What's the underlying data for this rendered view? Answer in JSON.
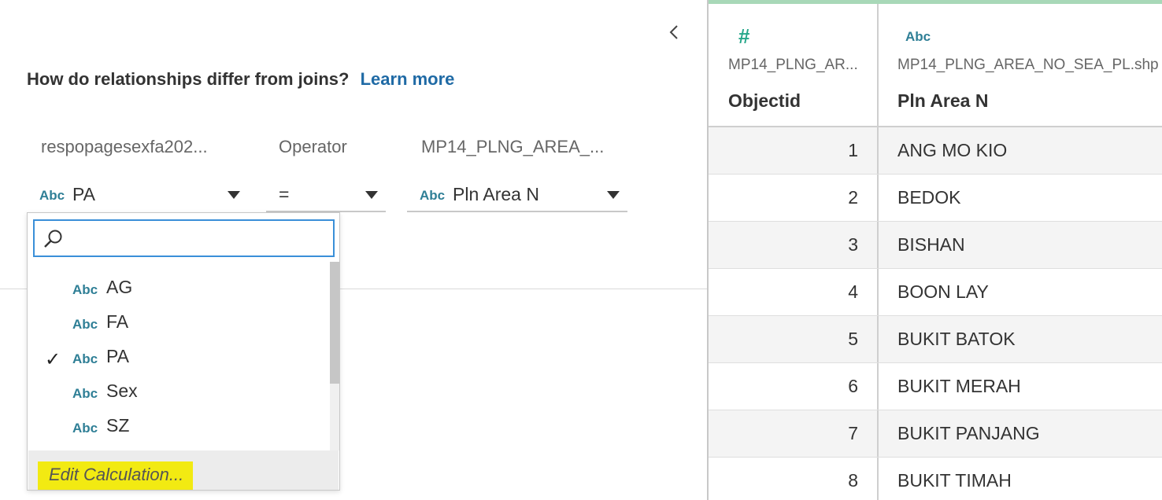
{
  "help": {
    "question": "How do relationships differ from joins?",
    "link": "Learn more"
  },
  "columns": {
    "left_table": "respopagesexfa202...",
    "operator": "Operator",
    "right_table": "MP14_PLNG_AREA_..."
  },
  "selectors": {
    "left": {
      "type": "Abc",
      "value": "PA"
    },
    "operator": {
      "value": "="
    },
    "right": {
      "type": "Abc",
      "value": "Pln Area N"
    }
  },
  "dropdown": {
    "search_value": "",
    "items": [
      {
        "type": "Abc",
        "name": "AG",
        "checked": false
      },
      {
        "type": "Abc",
        "name": "FA",
        "checked": false
      },
      {
        "type": "Abc",
        "name": "PA",
        "checked": true
      },
      {
        "type": "Abc",
        "name": "Sex",
        "checked": false
      },
      {
        "type": "Abc",
        "name": "SZ",
        "checked": false
      }
    ],
    "check_glyph": "✓",
    "edit_calculation": "Edit Calculation..."
  },
  "grid": {
    "columns": [
      {
        "type_icon": "#",
        "source": "MP14_PLNG_AR...",
        "field": "Objectid"
      },
      {
        "type_icon": "Abc",
        "source": "MP14_PLNG_AREA_NO_SEA_PL.shp",
        "field": "Pln Area N"
      }
    ],
    "rows": [
      {
        "objectid": "1",
        "pln_area_n": "ANG MO KIO"
      },
      {
        "objectid": "2",
        "pln_area_n": "BEDOK"
      },
      {
        "objectid": "3",
        "pln_area_n": "BISHAN"
      },
      {
        "objectid": "4",
        "pln_area_n": "BOON LAY"
      },
      {
        "objectid": "5",
        "pln_area_n": "BUKIT BATOK"
      },
      {
        "objectid": "6",
        "pln_area_n": "BUKIT MERAH"
      },
      {
        "objectid": "7",
        "pln_area_n": "BUKIT PANJANG"
      },
      {
        "objectid": "8",
        "pln_area_n": "BUKIT TIMAH"
      }
    ]
  },
  "colors": {
    "link": "#1f6aa5",
    "abc_type": "#2f7f96",
    "number_type": "#26a78a",
    "search_focus": "#3a8fd8",
    "highlight": "#f2ea12",
    "grid_accent": "#a8d8b8"
  }
}
